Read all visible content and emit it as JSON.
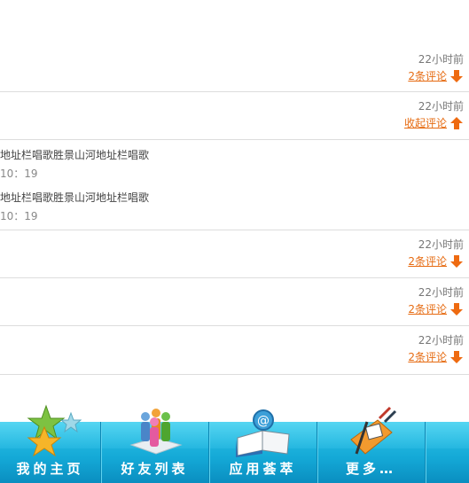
{
  "feed": {
    "items": [
      {
        "time": "22小时前",
        "action": "2条评论",
        "direction": "down"
      },
      {
        "time": "22小时前",
        "action": "收起评论",
        "direction": "up"
      },
      {
        "time": "22小时前",
        "action": "2条评论",
        "direction": "down"
      },
      {
        "time": "22小时前",
        "action": "2条评论",
        "direction": "down"
      },
      {
        "time": "22小时前",
        "action": "2条评论",
        "direction": "down"
      }
    ],
    "replies": [
      {
        "text": "地址栏唱歌胜景山河地址栏唱歌",
        "time": "10：19"
      },
      {
        "text": "地址栏唱歌胜景山河地址栏唱歌",
        "time": "10：19"
      }
    ]
  },
  "nav": {
    "items": [
      {
        "label": "我的主页",
        "icon": "stars-icon"
      },
      {
        "label": "好友列表",
        "icon": "friends-icon"
      },
      {
        "label": "应用荟萃",
        "icon": "book-icon"
      },
      {
        "label": "更多…",
        "icon": "paint-tools-icon"
      }
    ]
  },
  "colors": {
    "accent": "#e66b12",
    "nav": "#1aa9d8"
  }
}
